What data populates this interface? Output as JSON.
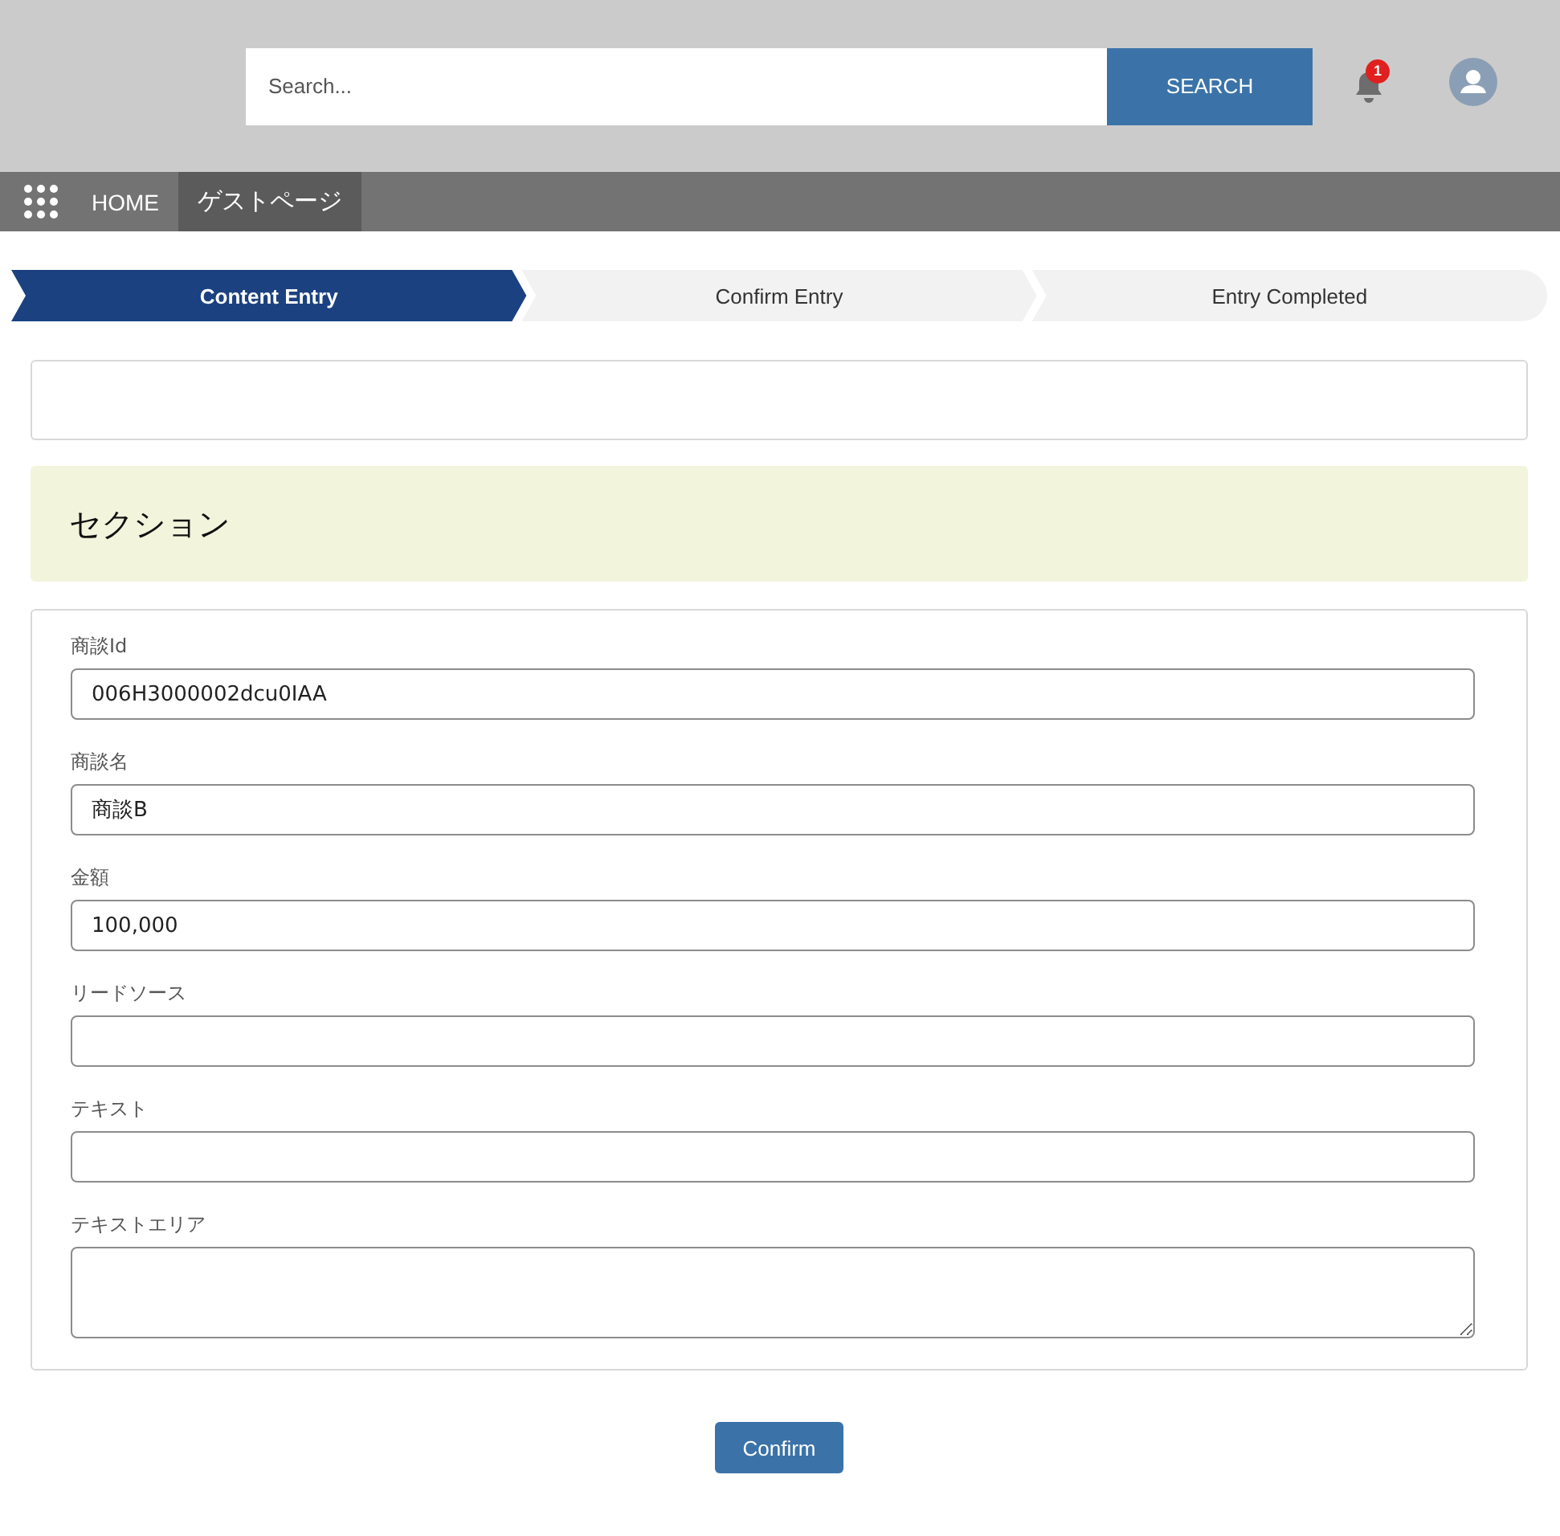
{
  "header": {
    "search": {
      "placeholder": "Search..."
    },
    "search_button": "SEARCH",
    "notifications": {
      "badge": "1"
    }
  },
  "nav": {
    "items": [
      {
        "label": "HOME",
        "selected": false
      },
      {
        "label": "ゲストページ",
        "selected": true
      }
    ]
  },
  "path": {
    "steps": [
      {
        "label": "Content Entry",
        "selected": true
      },
      {
        "label": "Confirm Entry",
        "selected": false
      },
      {
        "label": "Entry Completed",
        "selected": false
      }
    ]
  },
  "section": {
    "title": "セクション"
  },
  "form": {
    "fields": [
      {
        "kind": "input",
        "label": "商談Id",
        "value": "006H3000002dcu0IAA"
      },
      {
        "kind": "input",
        "label": "商談名",
        "value": "商談B"
      },
      {
        "kind": "input",
        "label": "金額",
        "value": "100,000"
      },
      {
        "kind": "input",
        "label": "リードソース"
      },
      {
        "kind": "input",
        "label": "テキスト"
      },
      {
        "kind": "textarea",
        "label": "テキストエリア"
      }
    ]
  },
  "confirm_button": "Confirm"
}
